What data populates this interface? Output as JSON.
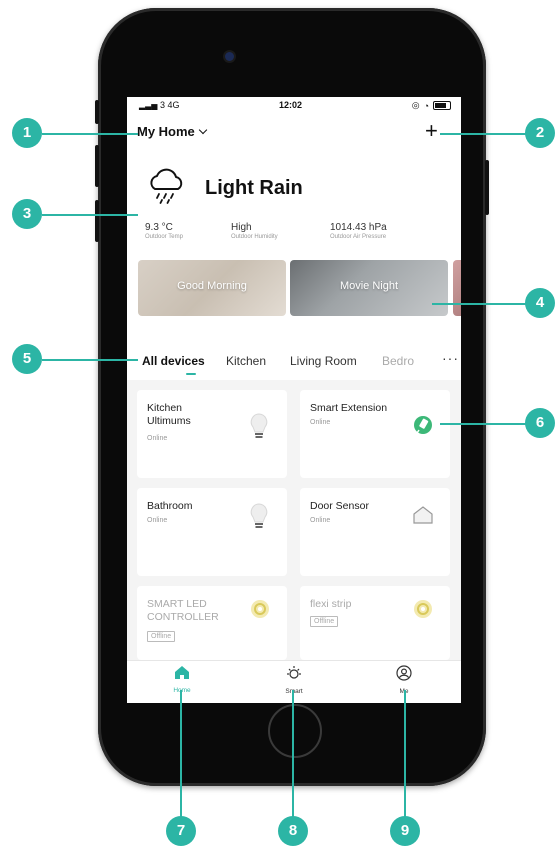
{
  "status_bar": {
    "carrier": "3  4G",
    "time": "12:02"
  },
  "header": {
    "home_name": "My Home",
    "add_label": "+"
  },
  "weather": {
    "condition": "Light Rain",
    "stats": [
      {
        "value": "9.3 °C",
        "label": "Outdoor Temp"
      },
      {
        "value": "High",
        "label": "Outdoor Humidity"
      },
      {
        "value": "1014.43 hPa",
        "label": "Outdoor Air Pressure"
      }
    ]
  },
  "scenes": [
    {
      "label": "Good Morning"
    },
    {
      "label": "Movie Night"
    }
  ],
  "tabs": {
    "items": [
      "All devices",
      "Kitchen",
      "Living Room",
      "Bedro"
    ],
    "more": "···"
  },
  "devices": [
    {
      "name": "Kitchen\nUltimums",
      "status": "Online",
      "icon": "bulb-icon"
    },
    {
      "name": "Smart Extension",
      "status": "Online",
      "icon": "plug-icon"
    },
    {
      "name": "Bathroom",
      "status": "Online",
      "icon": "bulb-icon"
    },
    {
      "name": "Door Sensor",
      "status": "Online",
      "icon": "house-icon"
    },
    {
      "name": "SMART LED\nCONTROLLER",
      "status": "Offline",
      "icon": "led-strip-icon"
    },
    {
      "name": "flexi strip",
      "status": "Offline",
      "icon": "led-strip-icon"
    }
  ],
  "tab_bar": {
    "items": [
      {
        "label": "Home"
      },
      {
        "label": "Smart"
      },
      {
        "label": "Me"
      }
    ]
  },
  "callouts": [
    "1",
    "2",
    "3",
    "4",
    "5",
    "6",
    "7",
    "8",
    "9"
  ],
  "colors": {
    "accent": "#2cb5a5",
    "callout": "#2cb5a5"
  }
}
